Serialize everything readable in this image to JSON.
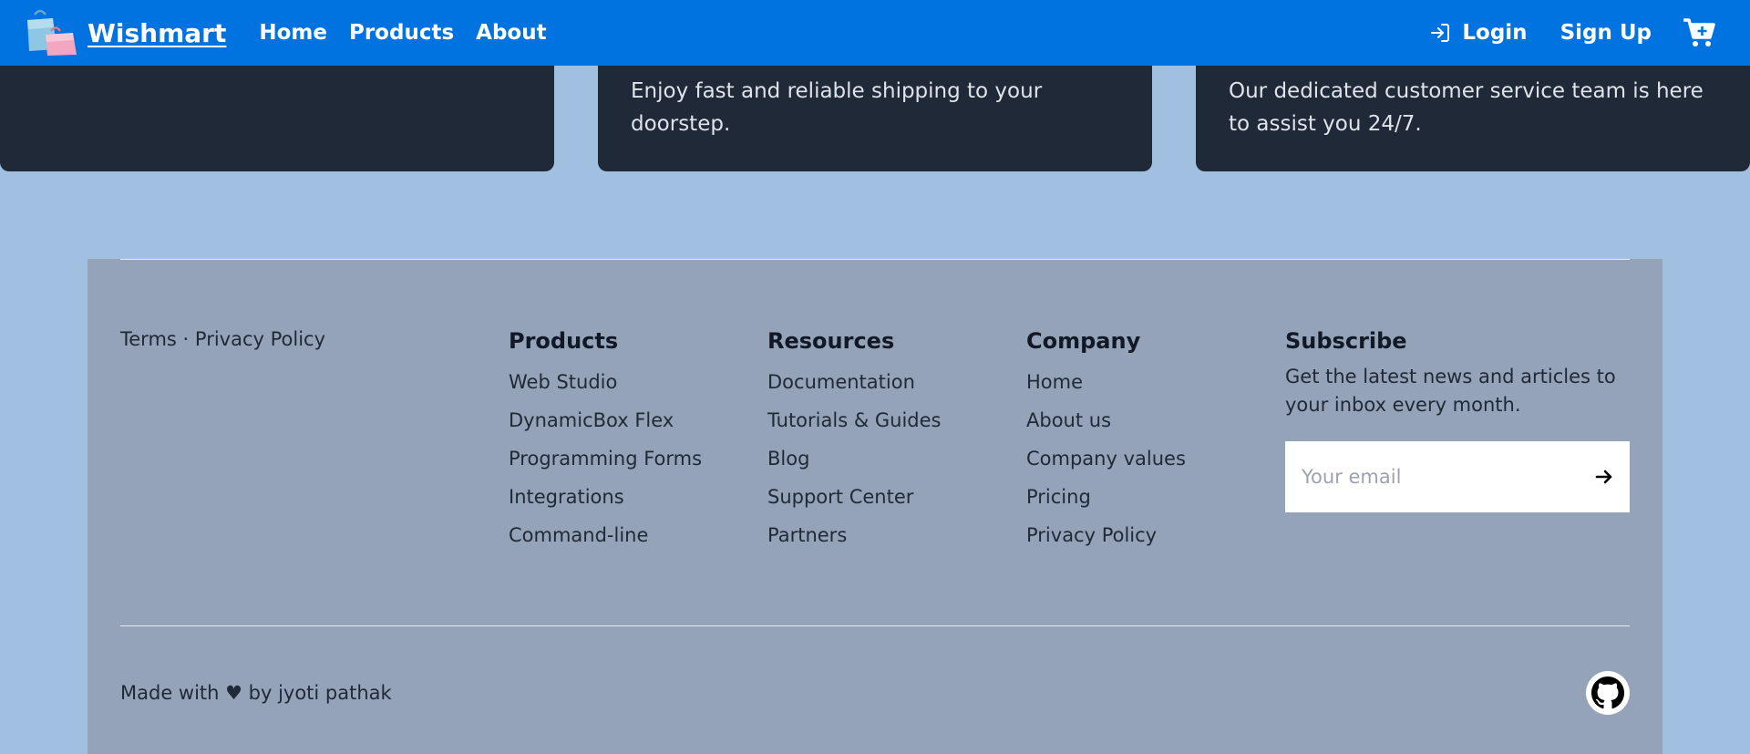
{
  "nav": {
    "brand": "Wishmart",
    "links": [
      "Home",
      "Products",
      "About"
    ],
    "login": "Login",
    "signup": "Sign Up"
  },
  "features": {
    "shipping_text": "Enjoy fast and reliable shipping to your doorstep.",
    "support_text": "Our dedicated customer service team is here to assist you 24/7."
  },
  "footer": {
    "terms": "Terms",
    "separator": "·",
    "privacy": "Privacy Policy",
    "columns": {
      "products": {
        "title": "Products",
        "items": [
          "Web Studio",
          "DynamicBox Flex",
          "Programming Forms",
          "Integrations",
          "Command-line"
        ]
      },
      "resources": {
        "title": "Resources",
        "items": [
          "Documentation",
          "Tutorials & Guides",
          "Blog",
          "Support Center",
          "Partners"
        ]
      },
      "company": {
        "title": "Company",
        "items": [
          "Home",
          "About us",
          "Company values",
          "Pricing",
          "Privacy Policy"
        ]
      }
    },
    "subscribe": {
      "title": "Subscribe",
      "text": "Get the latest news and articles to your inbox every month.",
      "placeholder": "Your email"
    },
    "credit": "Made with ♥ by jyoti pathak"
  },
  "colors": {
    "navbar": "#0073e0",
    "page_bg": "#a1c0e1",
    "card_bg": "#1f2937",
    "footer_bg": "#94a3b8"
  },
  "icons": {
    "logo": "shopping-bags-icon",
    "login": "login-arrow-icon",
    "cart": "cart-plus-icon",
    "submit": "arrow-right-icon",
    "github": "github-icon"
  }
}
